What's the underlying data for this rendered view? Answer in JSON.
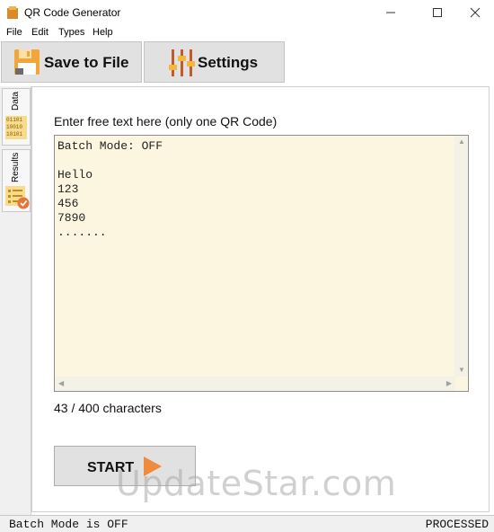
{
  "window": {
    "title": "QR Code Generator",
    "icon": "app-icon"
  },
  "menu": [
    "File",
    "Edit",
    "Types",
    "Help"
  ],
  "toolbar": {
    "save_label": "Save to File",
    "settings_label": "Settings"
  },
  "side_tabs": {
    "data_label": "Data",
    "data_icon_text": [
      "01101",
      "10010",
      "10101"
    ],
    "results_label": "Results"
  },
  "main": {
    "prompt": "Enter free text here (only one QR Code)",
    "text_value": "Batch Mode: OFF\n\nHello\n123\n456\n7890\n.......",
    "char_count": "43 / 400 characters",
    "start_label": "START"
  },
  "watermark": "UpdateStar.com",
  "status": {
    "left": "Batch Mode is OFF",
    "right": "PROCESSED"
  },
  "colors": {
    "textarea_bg": "#fcf6e1",
    "accent_orange": "#f08a3c",
    "button_bg": "#e1e1e1"
  }
}
